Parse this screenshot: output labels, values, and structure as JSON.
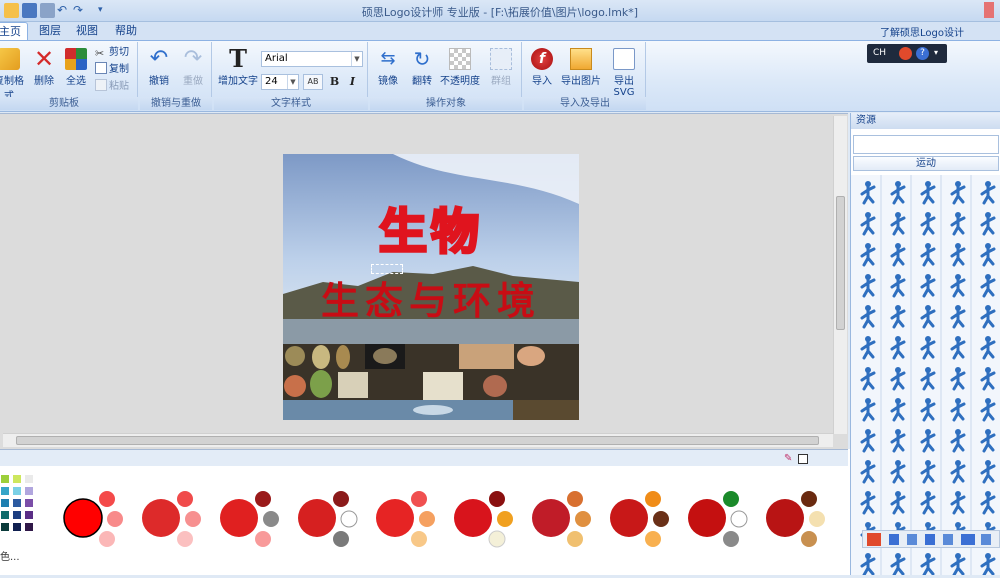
{
  "window": {
    "title": "硕思Logo设计师 专业版 - [F:\\拓展价值\\图片\\logo.lmk*]"
  },
  "tabs": [
    {
      "label": "主页"
    },
    {
      "label": "图层"
    },
    {
      "label": "视图"
    },
    {
      "label": "帮助"
    }
  ],
  "right_link": "了解硕思Logo设计",
  "groups": {
    "clipboard": {
      "label": "剪贴板",
      "format": "复制格式",
      "delete": "删除",
      "select_all": "全选",
      "cut": "剪切",
      "copy": "复制",
      "paste": "粘贴"
    },
    "undo": {
      "label": "撤销与重做",
      "undo": "撤销",
      "redo": "重做"
    },
    "text": {
      "label": "文字样式",
      "add_text": "增加文字",
      "font": "Arial",
      "size": "24",
      "bold": "B",
      "italic": "I"
    },
    "object": {
      "label": "操作对象",
      "mirror": "镜像",
      "rotate": "翻转",
      "opacity": "不透明度",
      "group": "群组"
    },
    "io": {
      "label": "导入及导出",
      "import": "导入",
      "export_image": "导出图片",
      "export_svg": "导出SVG"
    }
  },
  "lang_bar": {
    "ch": "CH"
  },
  "artwork": {
    "title": "生物",
    "subtitle": "生态与环境"
  },
  "sidebar": {
    "title": "资源",
    "search_value": "",
    "category": "运动"
  },
  "palette_more": "色...",
  "colors": {
    "accent": "#cc0000",
    "ribbon": "#dbe8f8"
  }
}
